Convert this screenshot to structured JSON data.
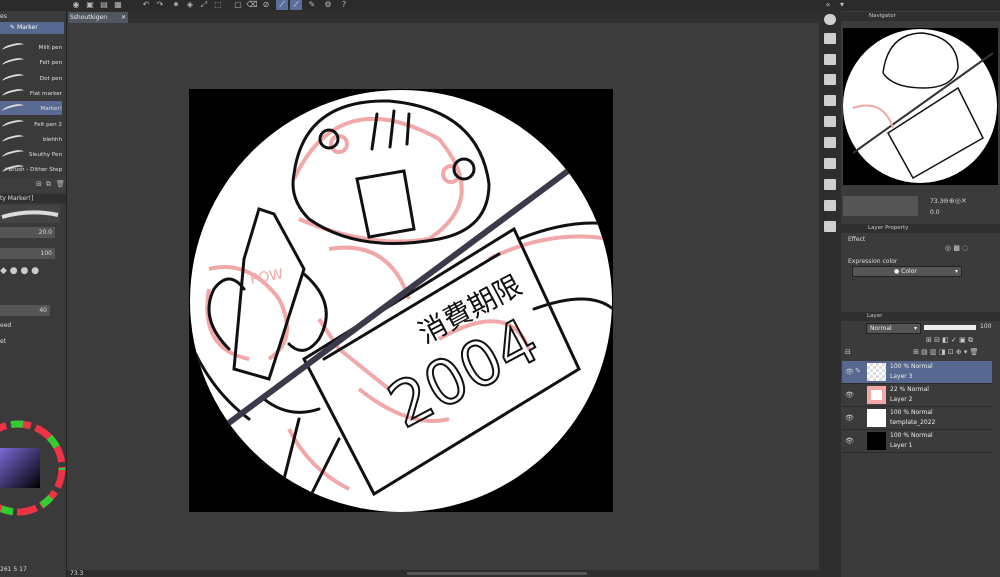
{
  "document_tab": "Sshoutkigen",
  "left": {
    "tool_tab": "es",
    "brush_group": "Marker",
    "brushes": [
      {
        "label": "Milli pen",
        "selected": false
      },
      {
        "label": "Felt pen",
        "selected": false
      },
      {
        "label": "Dot pen",
        "selected": false
      },
      {
        "label": "Flat marker",
        "selected": false
      },
      {
        "label": "Marker!",
        "selected": true
      },
      {
        "label": "Felt pen 2",
        "selected": false
      },
      {
        "label": "blehhh",
        "selected": false
      },
      {
        "label": "Sleuthy Pen",
        "selected": false
      },
      {
        "label": "l Brush - Dither Step 1",
        "selected": false
      }
    ],
    "tool_property_title": "ty Marker!]",
    "brush_size": "20.0",
    "opacity": "100",
    "param_40": "40",
    "label_eed": "eed",
    "label_et": "et"
  },
  "canvas": {
    "sign_text": "消費期限",
    "sign_number": "2004",
    "carton_text": "POW"
  },
  "status": {
    "zoom": "73.3",
    "left_values": "261",
    "left_values2": "5",
    "left_values3": "17"
  },
  "right": {
    "navigator_title": "Navigator",
    "zoom_value": "73.3",
    "angle_value": "0.0",
    "layer_property_title": "Layer Property",
    "effect_label": "Effect",
    "expression_color_label": "Expression color",
    "expression_color_value": "Color",
    "layer_tab": "Layer",
    "blend_mode": "Normal",
    "opacity_value": "100",
    "layers": [
      {
        "mode": "100 % Normal",
        "name": "Layer 3",
        "selected": true,
        "thumb": "white-check"
      },
      {
        "mode": "22 % Normal",
        "name": "Layer 2",
        "selected": false,
        "thumb": "pink"
      },
      {
        "mode": "100 % Normal",
        "name": "template_2022",
        "selected": false,
        "thumb": "white"
      },
      {
        "mode": "100 % Normal",
        "name": "Layer 1",
        "selected": false,
        "thumb": "black"
      }
    ]
  },
  "colors": {
    "accent": "#56688f",
    "sketch_pink": "#f2a8a8",
    "lineart": "#111111"
  }
}
